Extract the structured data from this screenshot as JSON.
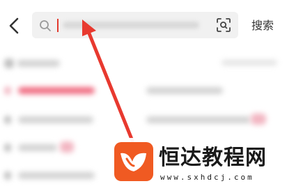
{
  "header": {
    "back_icon": "chevron-left-icon",
    "search": {
      "leading_icon": "search-icon",
      "value": "",
      "placeholder": "",
      "scan_icon": "scan-icon"
    },
    "search_button_label": "搜索"
  },
  "colors": {
    "search_background": "#f1f1f1",
    "cursor": "#e23a2e",
    "arrow": "#e8392f",
    "logo": "#f05a22"
  },
  "watermark": {
    "title": "恒达教程网",
    "domain": "www.sxhdcj.com"
  }
}
